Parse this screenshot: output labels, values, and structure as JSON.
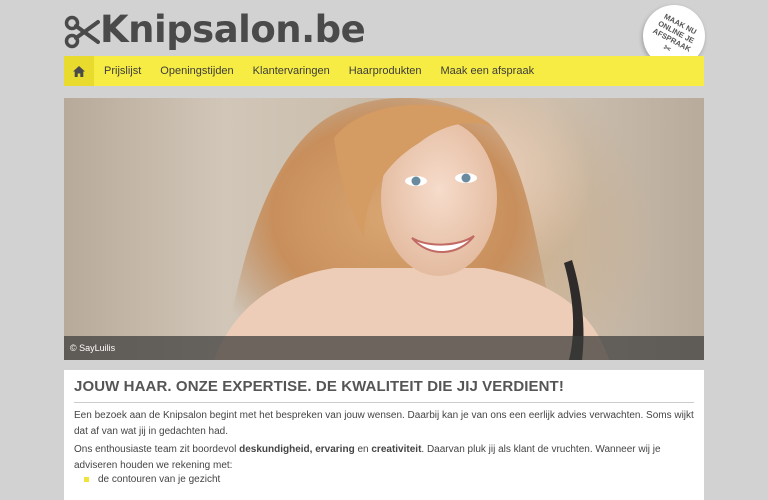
{
  "header": {
    "logo_text": "Knipsalon.be",
    "badge": {
      "line1": "MAAK NU",
      "line2": "ONLINE JE",
      "line3": "AFSPRAAK"
    }
  },
  "nav": {
    "home_icon": "home-icon",
    "items": [
      {
        "label": "Prijslijst"
      },
      {
        "label": "Openingstijden"
      },
      {
        "label": "Klantervaringen"
      },
      {
        "label": "Haarprodukten"
      },
      {
        "label": "Maak een afspraak"
      }
    ]
  },
  "hero": {
    "caption": "© SayLuilis"
  },
  "content": {
    "heading": "JOUW HAAR. ONZE EXPERTISE. DE KWALITEIT DIE JIJ VERDIENT!",
    "paragraph1": "Een bezoek aan de Knipsalon begint met het bespreken van jouw wensen. Daarbij kan je van ons een eerlijk advies verwachten. Soms wijkt dat af van wat jij in gedachten had.",
    "paragraph2": {
      "part1": "Ons enthousiaste team zit boordevol ",
      "bold1": "deskundigheid, ervaring",
      "part2": " en ",
      "bold2": "creativiteit",
      "part3": ". Daarvan pluk jij als klant de vruchten. Wanneer wij je adviseren houden we rekening met:"
    },
    "list": [
      "de contouren van je gezicht"
    ]
  },
  "colors": {
    "background": "#d2d2d2",
    "nav": "#f7ec44",
    "accent": "#e8db2e",
    "text": "#555555"
  }
}
